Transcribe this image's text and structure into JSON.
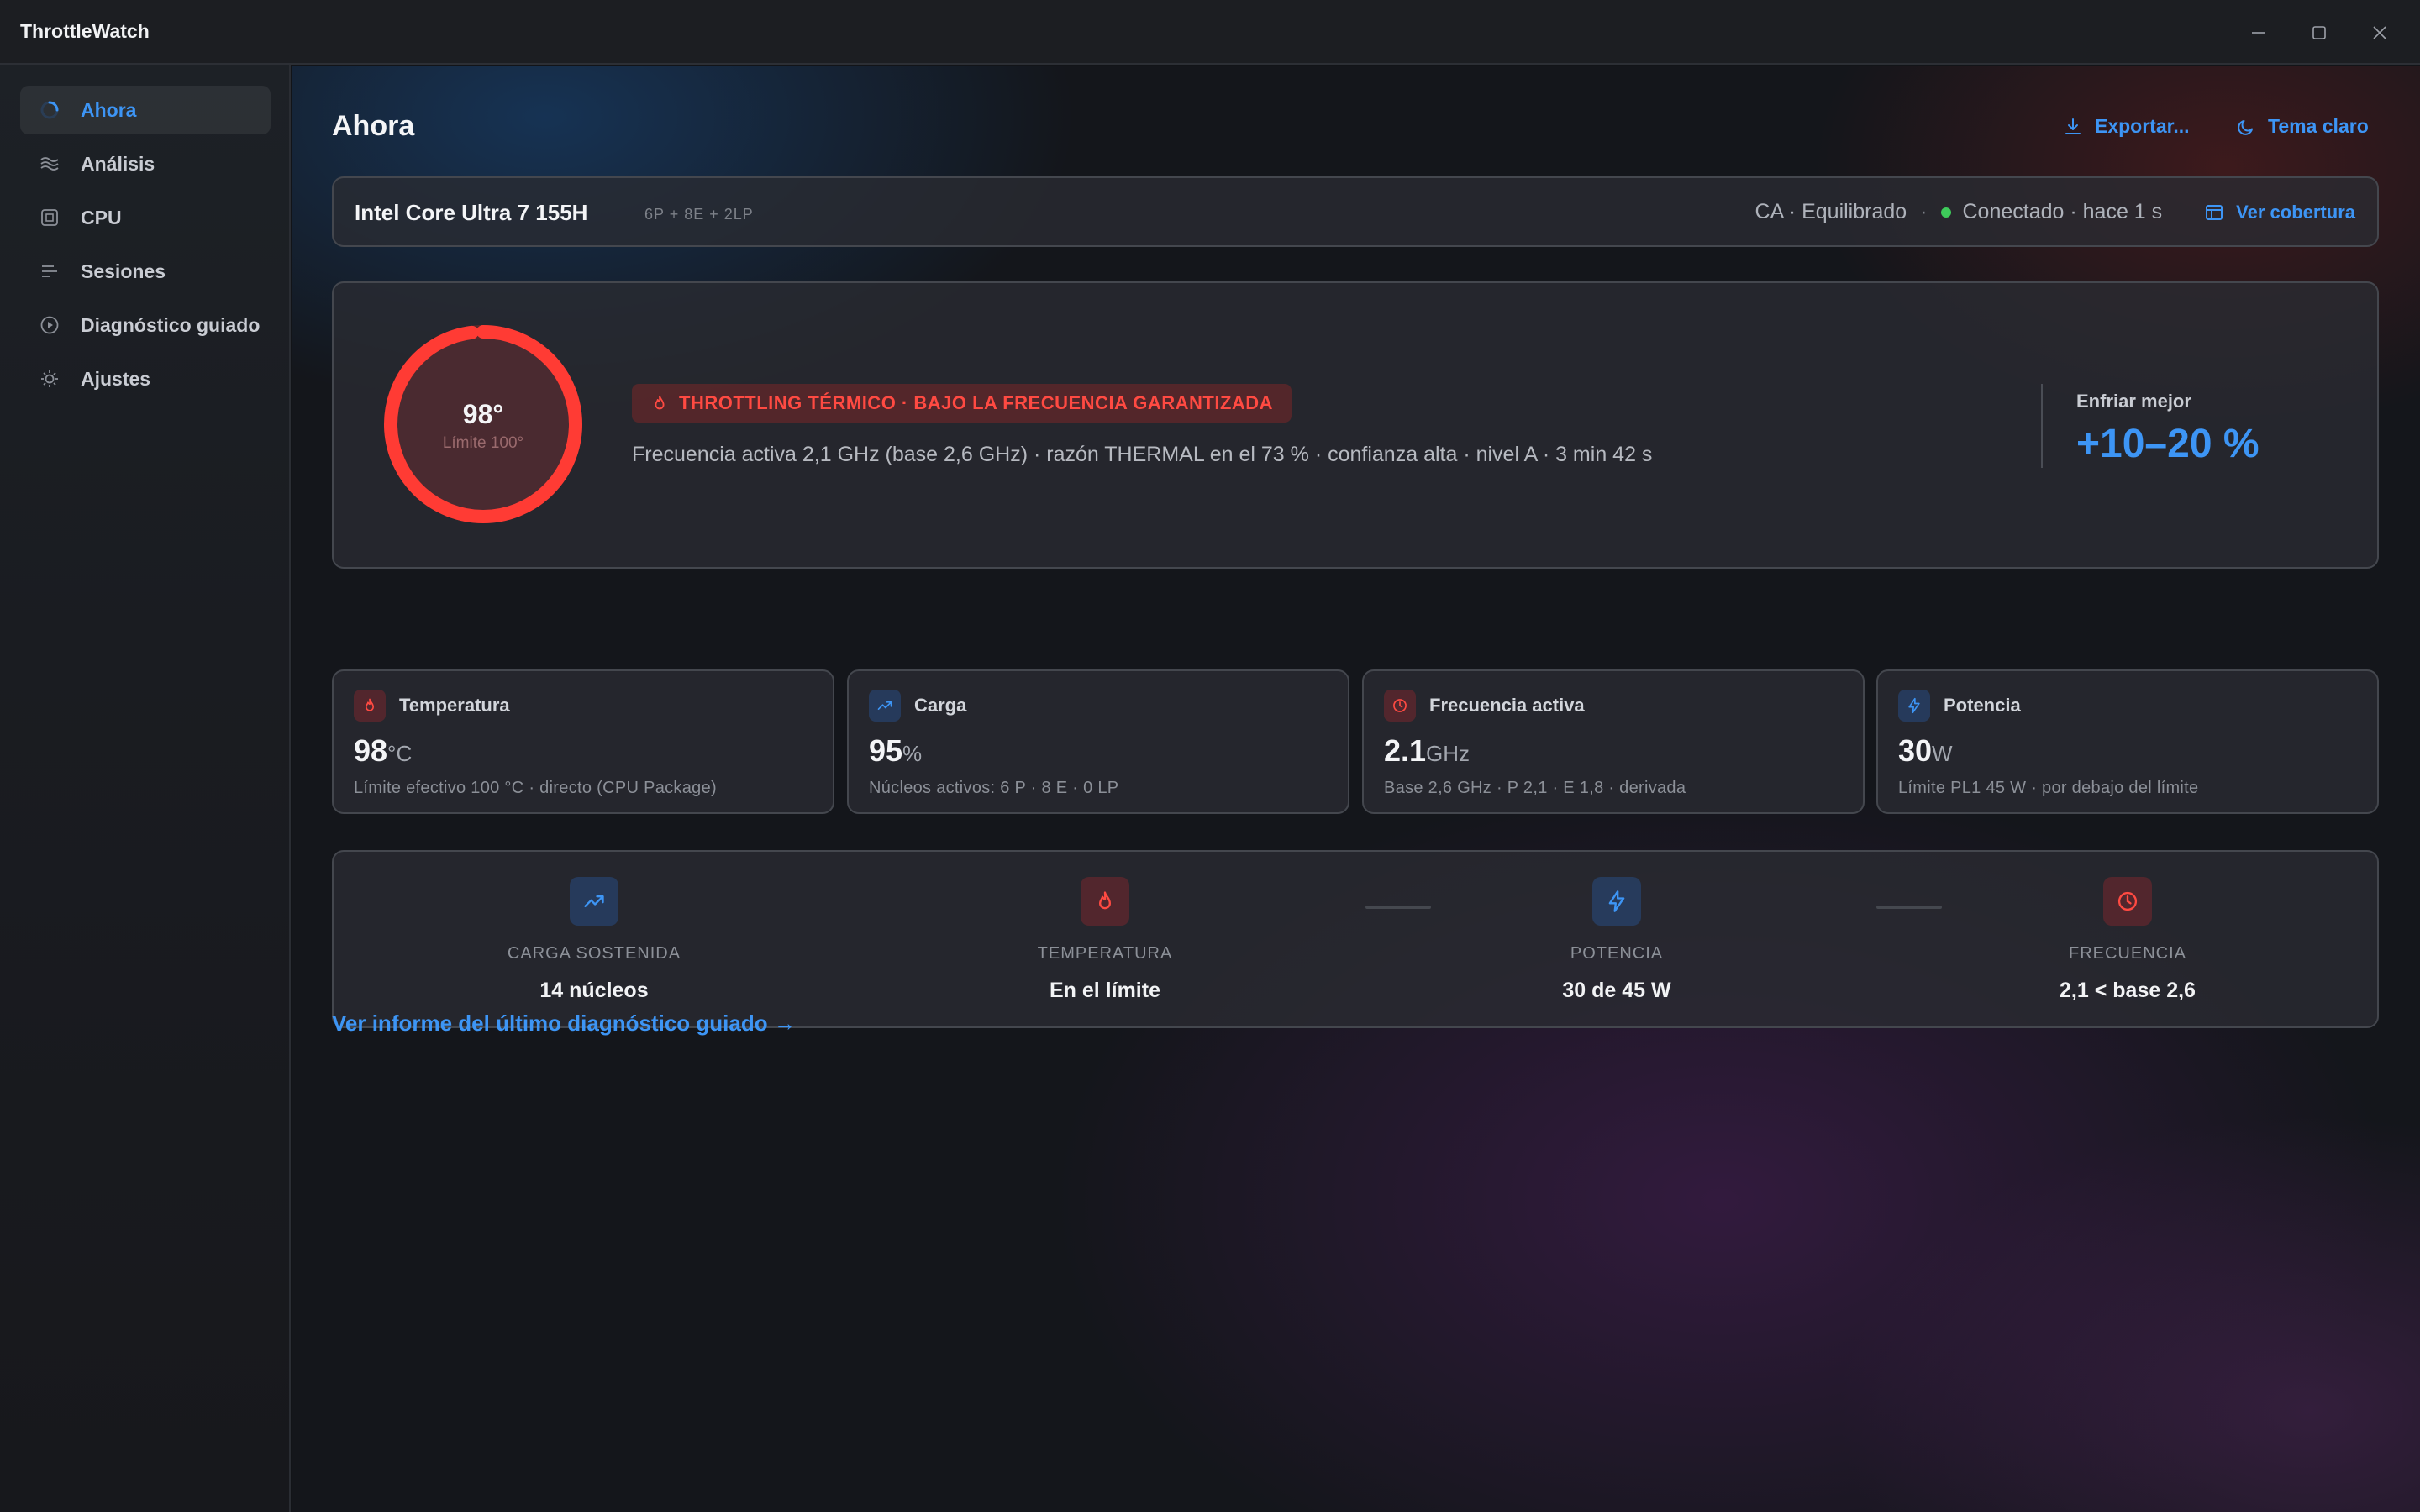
{
  "window": {
    "title": "ThrottleWatch"
  },
  "sidebar": {
    "items": [
      {
        "label": "Ahora",
        "icon": "spinner-icon",
        "active": true
      },
      {
        "label": "Análisis",
        "icon": "waves-icon"
      },
      {
        "label": "CPU",
        "icon": "chip-icon"
      },
      {
        "label": "Sesiones",
        "icon": "list-icon"
      },
      {
        "label": "Diagnóstico guiado",
        "icon": "play-circle-icon"
      },
      {
        "label": "Ajustes",
        "icon": "sun-gear-icon"
      }
    ]
  },
  "header": {
    "title": "Ahora",
    "export_label": "Exportar...",
    "theme_label": "Tema claro"
  },
  "cpu": {
    "name": "Intel Core Ultra 7 155H",
    "cores": "6P + 8E + 2LP",
    "power_mode": "CA · Equilibrado",
    "separator": "·",
    "connection": "Conectado · hace 1 s",
    "coverage_label": "Ver cobertura"
  },
  "hero": {
    "temperature": "98°",
    "limit": "Límite 100°",
    "gauge_fraction": 0.98,
    "alert": "THROTTLING TÉRMICO · BAJO LA FRECUENCIA GARANTIZADA",
    "description": "Frecuencia activa 2,1 GHz (base 2,6 GHz) · razón THERMAL en el 73 % · confianza alta · nivel A · 3 min 42 s",
    "kpi_label": "Enfriar mejor",
    "kpi_value": "+10–20 %"
  },
  "metrics": [
    {
      "label": "Temperatura",
      "value": "98",
      "unit": "°C",
      "desc": "Límite efectivo 100 °C · directo (CPU Package)",
      "icon": "flame-icon"
    },
    {
      "label": "Carga",
      "value": "95",
      "unit": "%",
      "desc": "Núcleos activos: 6 P · 8 E · 0 LP",
      "icon": "trend-icon"
    },
    {
      "label": "Frecuencia activa",
      "value": "2.1",
      "unit": "GHz",
      "desc": "Base 2,6 GHz · P 2,1 · E 1,8 · derivada",
      "icon": "clock-icon"
    },
    {
      "label": "Potencia",
      "value": "30",
      "unit": "W",
      "desc": "Límite PL1 45 W · por debajo del límite",
      "icon": "bolt-icon"
    }
  ],
  "pipeline": [
    {
      "label": "CARGA SOSTENIDA",
      "value": "14 núcleos",
      "icon": "trend-icon"
    },
    {
      "label": "TEMPERATURA",
      "value": "En el límite",
      "icon": "flame-icon"
    },
    {
      "label": "POTENCIA",
      "value": "30 de 45 W",
      "icon": "bolt-icon"
    },
    {
      "label": "FRECUENCIA",
      "value": "2,1 < base 2,6",
      "icon": "clock-icon"
    }
  ],
  "report_link": "Ver informe del último diagnóstico guiado →",
  "colors": {
    "accent": "#3d95f5",
    "danger": "#ff4a42",
    "ok": "#3ecb5a"
  }
}
